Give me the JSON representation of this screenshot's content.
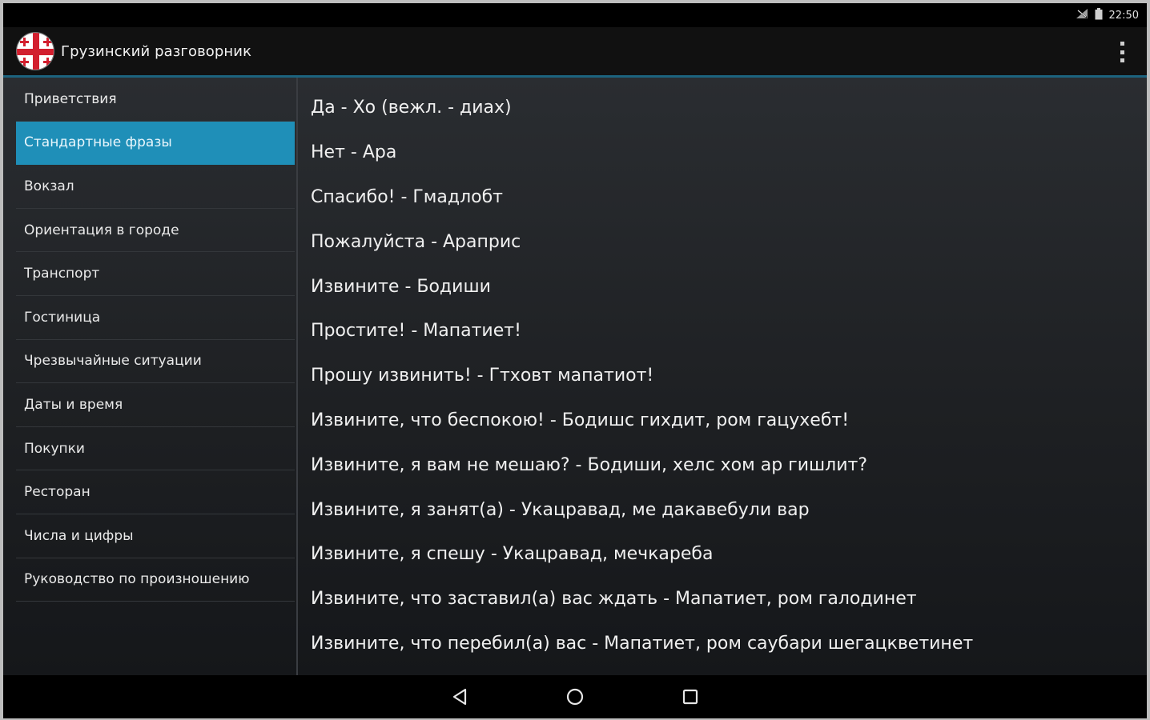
{
  "status_bar": {
    "time": "22:50",
    "icons": [
      "signal-off-icon",
      "battery-icon"
    ]
  },
  "action_bar": {
    "logo_icon": "georgian-flag-icon",
    "title": "Грузинский разговорник",
    "menu_icon": "overflow-menu-icon"
  },
  "colors": {
    "accent": "#1f8fb8",
    "action_bar_underline": "#33b5e5",
    "flag_red": "#d21f2e",
    "flag_white": "#ffffff"
  },
  "sidebar": {
    "selected_index": 1,
    "items": [
      {
        "label": "Приветствия"
      },
      {
        "label": "Стандартные фразы"
      },
      {
        "label": "Вокзал"
      },
      {
        "label": "Ориентация в городе"
      },
      {
        "label": "Транспорт"
      },
      {
        "label": "Гостиница"
      },
      {
        "label": "Чрезвычайные ситуации"
      },
      {
        "label": "Даты и время"
      },
      {
        "label": "Покупки"
      },
      {
        "label": "Ресторан"
      },
      {
        "label": "Числа и цифры"
      },
      {
        "label": "Руководство по произношению"
      }
    ]
  },
  "phrases": [
    "Да - Хо (вежл. - диах)",
    "Нет - Ара",
    "Спасибо! - Гмадлобт",
    "Пожалуйста - Араприс",
    "Извините - Бодиши",
    "Простите! - Мапатиет!",
    "Прошу извинить! - Гтховт мапатиот!",
    "Извините, что беспокою! - Бодишс гихдит, ром гацухебт!",
    "Извините, я вам не мешаю? - Бодиши, хелс хом ар гишлит?",
    "Извините, я занят(а) - Укацравад, ме дакавебули вар",
    "Извините, я спешу - Укацравад, мечкареба",
    "Извините, что заставил(а) вас ждать - Мапатиет, ром галодинет",
    "Извините, что перебил(а) вас - Мапатиет, ром саубари шегацкветинет"
  ],
  "nav_bar": {
    "back_icon": "back-triangle-icon",
    "home_icon": "home-circle-icon",
    "recents_icon": "recents-square-icon"
  }
}
